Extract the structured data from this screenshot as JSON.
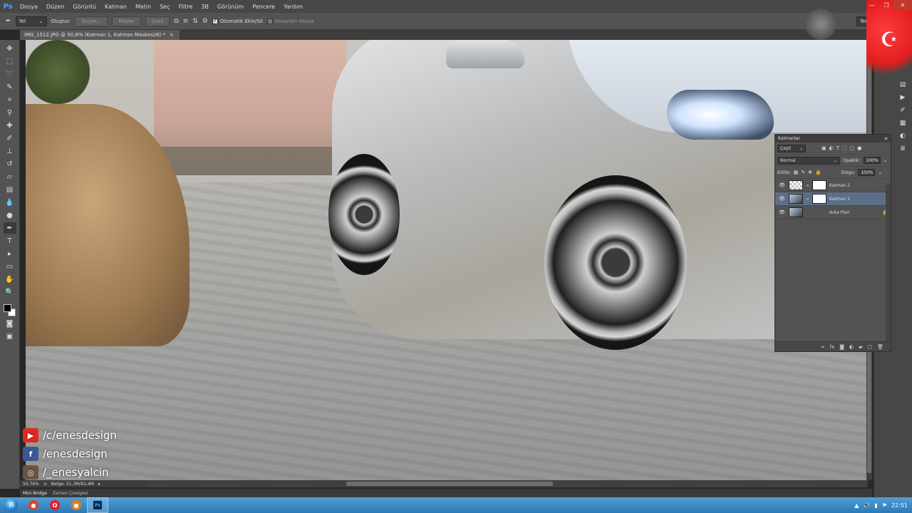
{
  "app": {
    "logo": "Ps"
  },
  "menu": [
    "Dosya",
    "Düzen",
    "Görüntü",
    "Katman",
    "Metin",
    "Seç",
    "Filtre",
    "3B",
    "Görünüm",
    "Pencere",
    "Yardım"
  ],
  "window_controls": {
    "minimize": "—",
    "restore": "❐",
    "close": "✕"
  },
  "options_bar": {
    "tool_icon": "pen-icon",
    "mode_select": "Yol",
    "make_label": "Oluştur:",
    "selection_btn": "Seçim...",
    "mask_btn": "Maske",
    "shape_btn": "Şekil",
    "auto_add_delete": "Otomatik Ekle/Sil",
    "align_edges": "Kenarları Hizala",
    "workspace": "Temeller"
  },
  "document": {
    "tab_title": "IMG_1512.JPG @ 50,8% (Katman 1, Katman Maskesi/8) *",
    "close": "×"
  },
  "status": {
    "zoom": "50,76%",
    "doc_size": "Belge: 51,3M/91,4M"
  },
  "bottom_tabs": [
    "Mini Bridge",
    "Zaman Çizelgesi"
  ],
  "social": [
    {
      "icon": "youtube-icon",
      "glyph": "▶",
      "text": "/c/enesdesign"
    },
    {
      "icon": "facebook-icon",
      "glyph": "f",
      "text": "/enesdesign"
    },
    {
      "icon": "instagram-icon",
      "glyph": "◎",
      "text": "/_enesyalcin"
    }
  ],
  "layers_panel": {
    "title": "Katmanlar",
    "filter": "Çeşit",
    "blend_mode": "Normal",
    "opacity_label": "Opaklık:",
    "opacity_value": "100%",
    "lock_label": "Kilitle:",
    "fill_label": "Dolgu:",
    "fill_value": "100%",
    "layers": [
      {
        "name": "Katman 2",
        "selected": false
      },
      {
        "name": "Katman 1",
        "selected": true
      },
      {
        "name": "Arka Plan",
        "selected": false
      }
    ]
  },
  "taskbar": {
    "time": "22:51"
  }
}
